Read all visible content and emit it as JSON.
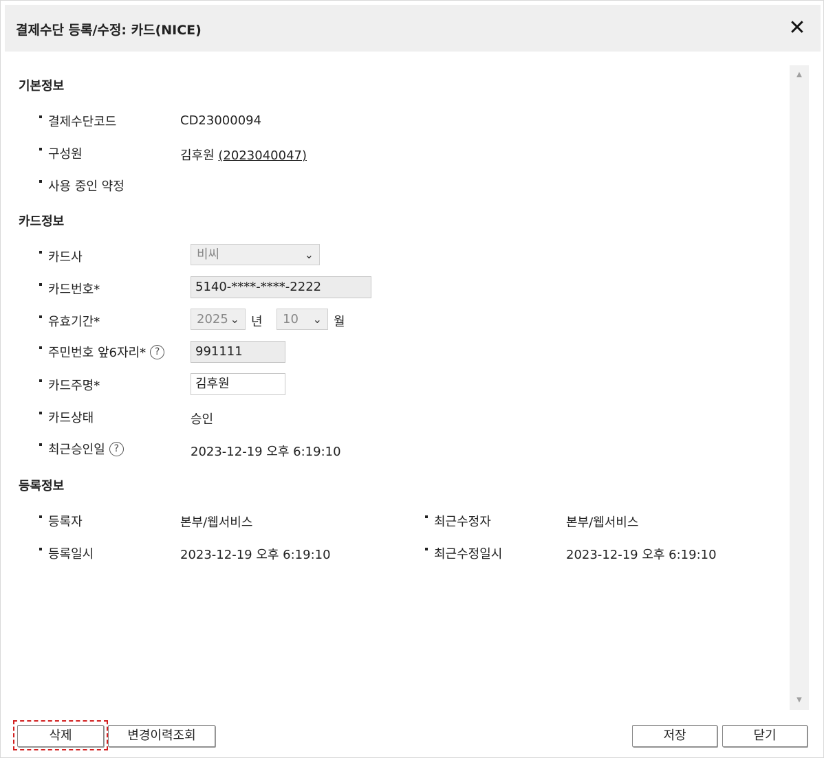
{
  "dialog": {
    "title": "결제수단 등록/수정: 카드(NICE)",
    "close_symbol": "✕"
  },
  "basic": {
    "section_title": "기본정보",
    "code_label": "결제수단코드",
    "code_value": "CD23000094",
    "member_label": "구성원",
    "member_name": "김후원",
    "member_open": "(",
    "member_id": "2023040047",
    "member_close": ")",
    "contract_label": "사용 중인 약정"
  },
  "card": {
    "section_title": "카드정보",
    "company_label": "카드사",
    "company_value": "비씨",
    "number_label": "카드번호*",
    "number_value": "5140-****-****-2222",
    "expiry_label": "유효기간*",
    "expiry_year": "2025",
    "year_unit": "년",
    "expiry_month": "10",
    "month_unit": "월",
    "rrn_label": "주민번호 앞6자리*",
    "rrn_value": "991111",
    "owner_label": "카드주명*",
    "owner_value": "김후원",
    "status_label": "카드상태",
    "status_value": "승인",
    "approved_label": "최근승인일",
    "approved_value": "2023-12-19 오후 6:19:10",
    "help_symbol": "?"
  },
  "registration": {
    "section_title": "등록정보",
    "registrant_label": "등록자",
    "registrant_value": "본부/웹서비스",
    "modifier_label": "최근수정자",
    "modifier_value": "본부/웹서비스",
    "reg_date_label": "등록일시",
    "reg_date_value": "2023-12-19 오후 6:19:10",
    "mod_date_label": "최근수정일시",
    "mod_date_value": "2023-12-19 오후 6:19:10"
  },
  "footer": {
    "delete_label": "삭제",
    "history_label": "변경이력조회",
    "save_label": "저장",
    "close_label": "닫기"
  },
  "icons": {
    "chevron": "⌄",
    "scroll_up": "▲",
    "scroll_down": "▼"
  }
}
